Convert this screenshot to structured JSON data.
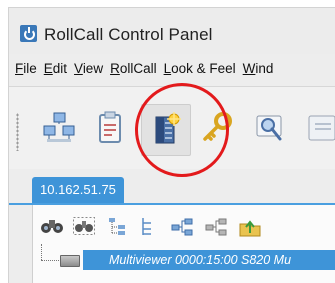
{
  "window": {
    "title": "RollCall Control Panel",
    "icon": "rollcall-app-icon"
  },
  "menubar": {
    "items": [
      {
        "label": "File",
        "underline": "F",
        "rest": "ile"
      },
      {
        "label": "Edit",
        "underline": "E",
        "rest": "dit"
      },
      {
        "label": "View",
        "underline": "V",
        "rest": "iew"
      },
      {
        "label": "RollCall",
        "underline": "R",
        "rest": "ollCall"
      },
      {
        "label": "Look & Feel",
        "underline": "L",
        "rest": "ook & Feel"
      },
      {
        "label": "Window",
        "underline": "W",
        "rest": "ind"
      }
    ]
  },
  "toolbar": {
    "buttons": [
      {
        "icon": "network-computers-icon"
      },
      {
        "icon": "clipboard-checklist-icon"
      },
      {
        "icon": "server-star-icon",
        "selected": true
      },
      {
        "icon": "key-icon"
      },
      {
        "icon": "certificate-search-icon"
      },
      {
        "icon": "partial-icon"
      }
    ],
    "highlighted_button": "server-star-icon",
    "highlight_color": "#e31a1c"
  },
  "tabs": [
    {
      "label": "10.162.51.75",
      "active": true
    }
  ],
  "panel_toolbar": {
    "icons": [
      "binoculars-icon",
      "binoculars-dotted-icon",
      "tree-expand-icon",
      "tree-collapse-icon",
      "network-nodes-icon",
      "network-nodes-gray-icon",
      "folder-up-icon"
    ]
  },
  "tree": {
    "rows": [
      {
        "label": "Multiviewer 0000:15:00 S820 Mu",
        "selected": true
      }
    ]
  },
  "colors": {
    "accent": "#3e94d8",
    "highlight": "#e31a1c"
  }
}
